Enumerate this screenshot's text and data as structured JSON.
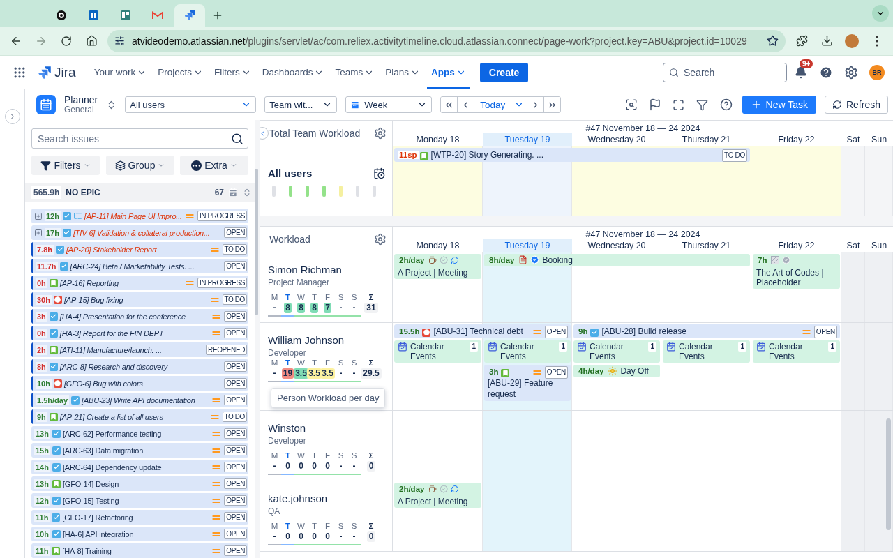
{
  "browser": {
    "tabs": [
      {
        "kind": "knot",
        "selected": false
      },
      {
        "kind": "square-logo",
        "selected": false
      },
      {
        "kind": "board",
        "selected": false
      },
      {
        "kind": "mail",
        "selected": false
      },
      {
        "kind": "jira",
        "selected": true
      }
    ],
    "url_host": "atvideodemo.atlassian.net",
    "url_path": "/plugins/servlet/ac/com.reliex.activitytimeline.cloud.atlassian.connect/page-work?project.key=ABU&project.id=10029"
  },
  "jira": {
    "product": "Jira",
    "menu": [
      {
        "label": "Your work",
        "selected": false
      },
      {
        "label": "Projects",
        "selected": false
      },
      {
        "label": "Filters",
        "selected": false
      },
      {
        "label": "Dashboards",
        "selected": false
      },
      {
        "label": "Teams",
        "selected": false
      },
      {
        "label": "Plans",
        "selected": false
      },
      {
        "label": "Apps",
        "selected": true
      }
    ],
    "create": "Create",
    "search": {
      "placeholder": "Search"
    },
    "notifications": "9+",
    "avatar": "BR"
  },
  "toolbar": {
    "app_title": "Planner",
    "app_subtitle": "General",
    "user_filter": "All users",
    "team_filter": "Team wit...",
    "period": "Week",
    "today": "Today",
    "new_task": "New Task",
    "refresh": "Refresh"
  },
  "issues_panel": {
    "search": {
      "placeholder": "Search issues"
    },
    "buttons": [
      {
        "label": "Filters",
        "kind": "filter"
      },
      {
        "label": "Group",
        "kind": "group"
      },
      {
        "label": "Extra",
        "kind": "extra"
      }
    ],
    "epic": {
      "hours": "565.9h",
      "name": "NO EPIC",
      "count": "67"
    },
    "issues": [
      {
        "expandable": true,
        "marked": false,
        "hours": "12h",
        "over": false,
        "kind": "task",
        "subtasks": true,
        "title": "[AP-11] Main Page UI Impro...",
        "italic": true,
        "overdue": true,
        "priority": true,
        "status": "IN PROGRESS"
      },
      {
        "expandable": true,
        "marked": false,
        "hours": "17h",
        "over": false,
        "kind": "task",
        "subtasks": false,
        "title": "[TIV-6] Validation & collateral production...",
        "italic": true,
        "overdue": true,
        "priority": false,
        "status": "OPEN"
      },
      {
        "expandable": false,
        "marked": true,
        "hours": "7.8h",
        "over": true,
        "kind": "task",
        "subtasks": false,
        "title": "[AP-20] Stakeholder Report",
        "italic": true,
        "overdue": true,
        "priority": true,
        "status": "TO DO"
      },
      {
        "expandable": false,
        "marked": true,
        "hours": "11.7h",
        "over": true,
        "kind": "task",
        "subtasks": false,
        "title": "[ARC-24] Beta / Marketability Tests. ...",
        "italic": true,
        "overdue": false,
        "priority": false,
        "status": "OPEN"
      },
      {
        "expandable": false,
        "marked": true,
        "hours": "0h",
        "over": true,
        "kind": "story",
        "subtasks": false,
        "title": "[AP-16] Reporting",
        "italic": true,
        "overdue": false,
        "priority": true,
        "status": "IN PROGRESS"
      },
      {
        "expandable": false,
        "marked": true,
        "hours": "30h",
        "over": true,
        "kind": "bug",
        "subtasks": false,
        "title": "[AP-15] Bug fixing",
        "italic": true,
        "overdue": false,
        "priority": true,
        "status": "TO DO"
      },
      {
        "expandable": false,
        "marked": true,
        "hours": "3h",
        "over": true,
        "kind": "task",
        "subtasks": false,
        "title": "[HA-4] Presentation for the conference",
        "italic": true,
        "overdue": false,
        "priority": true,
        "status": "OPEN"
      },
      {
        "expandable": false,
        "marked": true,
        "hours": "0h",
        "over": true,
        "kind": "task",
        "subtasks": false,
        "title": "[HA-3] Report for the FIN DEPT",
        "italic": true,
        "overdue": false,
        "priority": true,
        "status": "OPEN"
      },
      {
        "expandable": false,
        "marked": true,
        "hours": "2h",
        "over": true,
        "kind": "story",
        "subtasks": false,
        "title": "[ATI-11] Manufacture/launch. ...",
        "italic": true,
        "overdue": false,
        "priority": false,
        "status": "REOPENED"
      },
      {
        "expandable": false,
        "marked": true,
        "hours": "8h",
        "over": true,
        "kind": "task",
        "subtasks": false,
        "title": "[ARC-8] Research and discovery",
        "italic": true,
        "overdue": false,
        "priority": false,
        "status": "OPEN"
      },
      {
        "expandable": false,
        "marked": true,
        "hours": "10h",
        "over": false,
        "kind": "bug",
        "subtasks": false,
        "title": "[GFO-6] Bug with colors",
        "italic": true,
        "overdue": false,
        "priority": false,
        "status": "OPEN"
      },
      {
        "expandable": false,
        "marked": true,
        "hours": "1.5h/day",
        "over": false,
        "kind": "task",
        "subtasks": false,
        "title": "[ABU-23] Write API documentation",
        "italic": true,
        "overdue": false,
        "priority": true,
        "status": "OPEN"
      },
      {
        "expandable": false,
        "marked": true,
        "hours": "9h",
        "over": false,
        "kind": "story",
        "subtasks": false,
        "title": "[AP-21] Create a list of all users",
        "italic": true,
        "overdue": false,
        "priority": true,
        "status": "TO DO"
      },
      {
        "expandable": false,
        "marked": false,
        "hours": "13h",
        "over": false,
        "kind": "task",
        "subtasks": false,
        "title": "[ARC-62] Performance testing",
        "italic": false,
        "overdue": false,
        "priority": true,
        "status": "OPEN"
      },
      {
        "expandable": false,
        "marked": false,
        "hours": "15h",
        "over": false,
        "kind": "task",
        "subtasks": false,
        "title": "[ARC-63] Data migration",
        "italic": false,
        "overdue": false,
        "priority": true,
        "status": "OPEN"
      },
      {
        "expandable": false,
        "marked": false,
        "hours": "14h",
        "over": false,
        "kind": "task",
        "subtasks": false,
        "title": "[ARC-64] Dependency update",
        "italic": false,
        "overdue": false,
        "priority": true,
        "status": "OPEN"
      },
      {
        "expandable": false,
        "marked": false,
        "hours": "13h",
        "over": false,
        "kind": "story",
        "subtasks": false,
        "title": "[GFO-14] Design",
        "italic": false,
        "overdue": false,
        "priority": true,
        "status": "OPEN"
      },
      {
        "expandable": false,
        "marked": false,
        "hours": "12h",
        "over": false,
        "kind": "task",
        "subtasks": false,
        "title": "[GFO-15] Testing",
        "italic": false,
        "overdue": false,
        "priority": true,
        "status": "OPEN"
      },
      {
        "expandable": false,
        "marked": false,
        "hours": "11h",
        "over": false,
        "kind": "task",
        "subtasks": false,
        "title": "[GFO-17] Refactoring",
        "italic": false,
        "overdue": false,
        "priority": true,
        "status": "OPEN"
      },
      {
        "expandable": false,
        "marked": false,
        "hours": "10h",
        "over": false,
        "kind": "task",
        "subtasks": false,
        "title": "[HA-6] API integration",
        "italic": false,
        "overdue": false,
        "priority": true,
        "status": "OPEN"
      },
      {
        "expandable": false,
        "marked": false,
        "hours": "11h",
        "over": false,
        "kind": "story",
        "subtasks": false,
        "title": "[HA-8] Training",
        "italic": false,
        "overdue": false,
        "priority": true,
        "status": "OPEN"
      }
    ]
  },
  "total_workload": {
    "title": "Total Team Workload",
    "week": "#47 November 18 — 24 2024",
    "days": [
      {
        "label": "Monday 18",
        "today": false
      },
      {
        "label": "Tuesday 19",
        "today": true
      },
      {
        "label": "Wednesday 20",
        "today": false
      },
      {
        "label": "Thursday 21",
        "today": false
      },
      {
        "label": "Friday 22",
        "today": false
      },
      {
        "label": "Sat",
        "today": false
      },
      {
        "label": "Sun",
        "today": false
      }
    ],
    "group": "All users",
    "bars": [
      {
        "color": "#dfe1e6"
      },
      {
        "color": "#94e28a"
      },
      {
        "color": "#94e28a"
      },
      {
        "color": "#94e28a"
      },
      {
        "color": "#f5f0a0"
      },
      {
        "color": "#dfe1e6"
      },
      {
        "color": "#dfe1e6"
      }
    ],
    "cells": [
      {
        "color": "#fdfde1"
      },
      {
        "color": "#eef4fc"
      },
      {
        "color": "#fdfde1"
      },
      {
        "color": "#fdfde1"
      },
      {
        "color": "#fdfde1"
      },
      {
        "color": "#f4f5f7"
      },
      {
        "color": "#f4f5f7"
      }
    ],
    "lane": [
      {
        "kind": "story",
        "amount": "11sp",
        "over": true,
        "title": "[WTP-20] Story Generating. ...",
        "priority": false,
        "status": "TO DO"
      },
      {
        "kind": "continued"
      },
      {
        "kind": "continued"
      },
      {
        "kind": "continued"
      },
      {
        "kind": "empty"
      },
      {
        "kind": "empty"
      },
      {
        "kind": "empty"
      }
    ]
  },
  "workload": {
    "title": "Workload",
    "week": "#47 November 18 — 24 2024",
    "days": [
      {
        "label": "Monday 18",
        "today": false,
        "weekend": false
      },
      {
        "label": "Tuesday 19",
        "today": true,
        "weekend": false
      },
      {
        "label": "Wednesday 20",
        "today": false,
        "weekend": false
      },
      {
        "label": "Thursday 21",
        "today": false,
        "weekend": false
      },
      {
        "label": "Friday 22",
        "today": false,
        "weekend": false
      },
      {
        "label": "Sat",
        "today": false,
        "weekend": true
      },
      {
        "label": "Sun",
        "today": false,
        "weekend": true
      }
    ],
    "people": [
      {
        "name": "Simon Richman",
        "role": "Project Manager",
        "days": [
          {
            "letter": "M",
            "value": "-",
            "kind": "past"
          },
          {
            "letter": "T",
            "value": "8",
            "kind": "today",
            "color": "#7fdcb5"
          },
          {
            "letter": "W",
            "value": "8",
            "kind": "future",
            "color": "#7fdcb5"
          },
          {
            "letter": "T",
            "value": "8",
            "kind": "future",
            "color": "#7fdcb5"
          },
          {
            "letter": "F",
            "value": "7",
            "kind": "future",
            "color": "#7fdcb5"
          },
          {
            "letter": "S",
            "value": "-",
            "kind": "future"
          },
          {
            "letter": "S",
            "value": "-",
            "kind": "future"
          }
        ],
        "sum_label": "Σ",
        "total": "31",
        "lanes": [
          [
            {
              "kind": "meeting",
              "amount": "2h/day",
              "title": "A Project | Meeting"
            },
            {
              "kind": "booking",
              "amount": "8h/day",
              "title": "Booking"
            },
            {
              "kind": "continued"
            },
            {
              "kind": "continued"
            },
            {
              "kind": "placeholder",
              "amount": "7h",
              "title": "The Art of Codes | Placeholder"
            },
            {
              "kind": "empty"
            },
            {
              "kind": "empty"
            }
          ]
        ]
      },
      {
        "name": "William Johnson",
        "role": "Developer",
        "tooltip": "Person Workload per day",
        "days": [
          {
            "letter": "M",
            "value": "-",
            "kind": "past"
          },
          {
            "letter": "T",
            "value": "19",
            "kind": "today",
            "color": "#f28b82"
          },
          {
            "letter": "W",
            "value": "3.5",
            "kind": "future",
            "color": "#7fdcb5"
          },
          {
            "letter": "T",
            "value": "3.5",
            "kind": "future",
            "color": "#fdf2a0"
          },
          {
            "letter": "F",
            "value": "3.5",
            "kind": "future",
            "color": "#fdf2a0"
          },
          {
            "letter": "S",
            "value": "-",
            "kind": "future"
          },
          {
            "letter": "S",
            "value": "-",
            "kind": "future"
          }
        ],
        "sum_label": "Σ",
        "total": "29.5",
        "lanes": [
          [
            {
              "kind": "bug",
              "amount": "15.5h",
              "over": false,
              "title": "[ABU-31] Technical debt",
              "priority": true,
              "status": "OPEN"
            },
            {
              "kind": "continued"
            },
            {
              "kind": "task",
              "amount": "9h",
              "over": false,
              "title": "[ABU-28] Build release",
              "priority": true,
              "status": "OPEN"
            },
            {
              "kind": "continued"
            },
            {
              "kind": "continued"
            },
            {
              "kind": "empty"
            },
            {
              "kind": "empty"
            }
          ],
          [
            {
              "kind": "calendar",
              "title": "Calendar Events",
              "count": "1"
            },
            {
              "kind": "calendar",
              "title": "Calendar Events",
              "count": "1"
            },
            {
              "kind": "calendar",
              "title": "Calendar Events",
              "count": "1"
            },
            {
              "kind": "calendar",
              "title": "Calendar Events",
              "count": "1"
            },
            {
              "kind": "calendar",
              "title": "Calendar Events",
              "count": "1"
            },
            {
              "kind": "empty"
            },
            {
              "kind": "empty"
            }
          ],
          [
            {
              "kind": "empty"
            },
            {
              "kind": "story",
              "amount": "3h",
              "over": false,
              "title": "[ABU-29] Feature request",
              "priority": true,
              "status": "OPEN"
            },
            {
              "kind": "dayoff",
              "amount": "4h/day",
              "title": "Day Off"
            },
            {
              "kind": "empty"
            },
            {
              "kind": "empty"
            },
            {
              "kind": "empty"
            },
            {
              "kind": "empty"
            }
          ]
        ]
      },
      {
        "name": "Winston",
        "role": "Developer",
        "days": [
          {
            "letter": "M",
            "value": "-",
            "kind": "past"
          },
          {
            "letter": "T",
            "value": "0",
            "kind": "today"
          },
          {
            "letter": "W",
            "value": "0",
            "kind": "future"
          },
          {
            "letter": "T",
            "value": "0",
            "kind": "future"
          },
          {
            "letter": "F",
            "value": "0",
            "kind": "future"
          },
          {
            "letter": "S",
            "value": "-",
            "kind": "future"
          },
          {
            "letter": "S",
            "value": "-",
            "kind": "future"
          }
        ],
        "sum_label": "Σ",
        "total": "0"
      },
      {
        "name": "kate.johnson",
        "role": "QA",
        "days": [
          {
            "letter": "M",
            "value": "-",
            "kind": "past"
          },
          {
            "letter": "T",
            "value": "0",
            "kind": "today"
          },
          {
            "letter": "W",
            "value": "0",
            "kind": "future"
          },
          {
            "letter": "T",
            "value": "0",
            "kind": "future"
          },
          {
            "letter": "F",
            "value": "0",
            "kind": "future"
          },
          {
            "letter": "S",
            "value": "-",
            "kind": "future"
          },
          {
            "letter": "S",
            "value": "-",
            "kind": "future"
          }
        ],
        "sum_label": "Σ",
        "total": "0",
        "lanes": [
          [
            {
              "kind": "meeting",
              "amount": "2h/day",
              "title": "A Project | Meeting"
            },
            {
              "kind": "empty"
            },
            {
              "kind": "empty"
            },
            {
              "kind": "empty"
            },
            {
              "kind": "empty"
            },
            {
              "kind": "empty"
            },
            {
              "kind": "empty"
            }
          ]
        ]
      }
    ]
  }
}
